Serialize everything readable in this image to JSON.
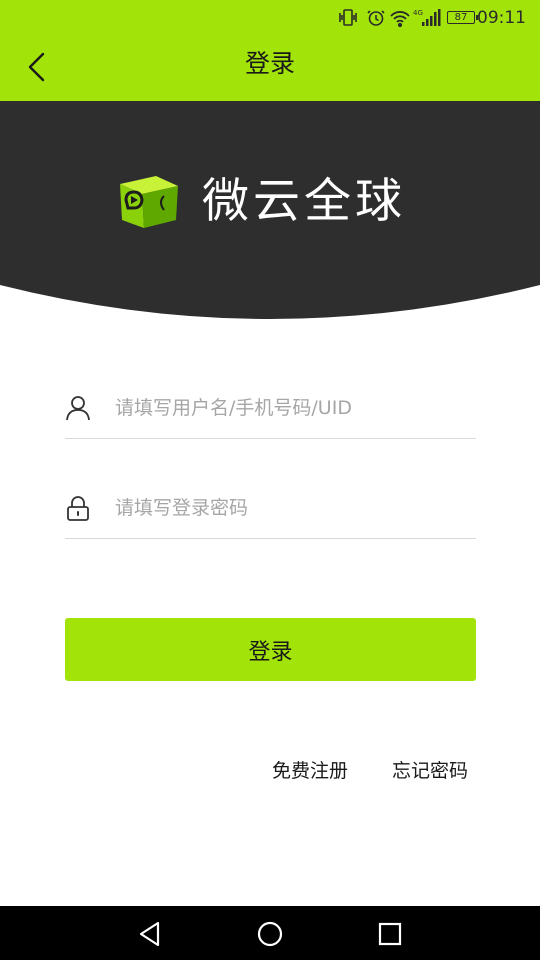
{
  "status_bar": {
    "time": "09:11",
    "battery": "87",
    "network": "4G",
    "icons": [
      "vibrate-icon",
      "alarm-icon",
      "wifi-icon",
      "signal-icon",
      "battery-icon"
    ]
  },
  "header": {
    "title": "登录",
    "back_icon": "chevron-left-icon"
  },
  "brand": {
    "name": "微云全球",
    "logo_icon": "cube-play-logo"
  },
  "form": {
    "username_placeholder": "请填写用户名/手机号码/UID",
    "password_placeholder": "请填写登录密码",
    "username_icon": "user-icon",
    "password_icon": "lock-icon",
    "submit_label": "登录"
  },
  "links": {
    "register": "免费注册",
    "forgot_password": "忘记密码"
  },
  "nav": {
    "icons": [
      "back-triangle-icon",
      "home-circle-icon",
      "recents-square-icon"
    ]
  },
  "colors": {
    "accent": "#a2e40a",
    "banner": "#2e2e2e",
    "nav": "#000000"
  }
}
